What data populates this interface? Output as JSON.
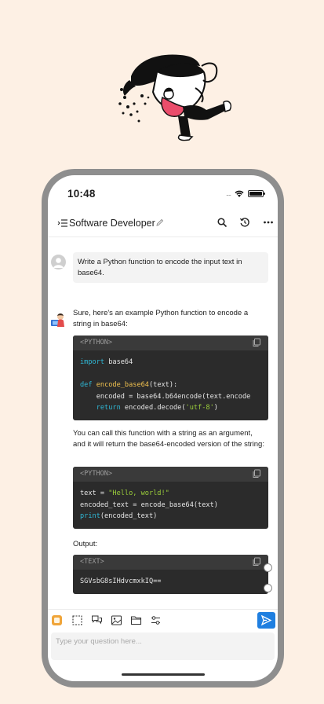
{
  "status_bar": {
    "time": "10:48",
    "signal_dots": "...."
  },
  "header": {
    "title": "Software Developer"
  },
  "messages": {
    "user_prompt": "Write a Python function to encode the input text in base64.",
    "bot_intro": "Sure, here's an example Python function to encode a string in base64:",
    "bot_middle": "You can call this function with a string as an argument, and it will return the base64-encoded version of the string:",
    "bot_output_label": "Output:"
  },
  "code_blocks": [
    {
      "lang": "<PYTHON>",
      "lines": [
        "import base64",
        "",
        "def encode_base64(text):",
        "    encoded = base64.b64encode(text.encode",
        "    return encoded.decode('utf-8')"
      ]
    },
    {
      "lang": "<PYTHON>",
      "lines": [
        "text = \"Hello, world!\"",
        "encoded_text = encode_base64(text)",
        "print(encoded_text)"
      ]
    },
    {
      "lang": "<TEXT>",
      "lines": [
        "SGVsbG8sIHdvcmxkIQ=="
      ]
    }
  ],
  "input": {
    "placeholder": "Type your question here..."
  },
  "colors": {
    "accent": "#1f7fe0",
    "background": "#fdf0e4",
    "code_bg": "#2b2b2b",
    "keyword": "#2fb8d6",
    "function": "#f2c24f",
    "string": "#9ccf3b"
  },
  "icons": {
    "header": [
      "menu-icon",
      "pencil-icon",
      "search-icon",
      "history-icon",
      "more-icon"
    ],
    "toolbar": [
      "plugin-icon",
      "selection-icon",
      "chat-bubbles-icon",
      "image-icon",
      "folder-icon",
      "settings-sliders-icon",
      "send-icon"
    ]
  }
}
